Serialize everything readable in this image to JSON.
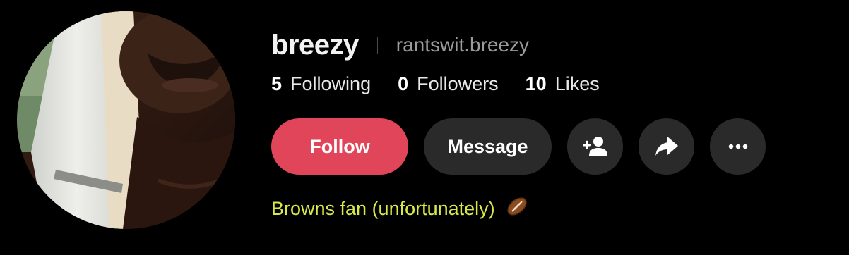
{
  "profile": {
    "display_name": "breezy",
    "username": "rantswit.breezy",
    "avatar": "profile-photo"
  },
  "stats": [
    {
      "count": "5",
      "label": "Following"
    },
    {
      "count": "0",
      "label": "Followers"
    },
    {
      "count": "10",
      "label": "Likes"
    }
  ],
  "actions": {
    "follow_label": "Follow",
    "message_label": "Message",
    "add_friend_icon": "person-plus-icon",
    "share_icon": "share-arrow-icon",
    "more_icon": "ellipsis-icon"
  },
  "bio": {
    "text": "Browns fan (unfortunately)",
    "emoji": "🏈",
    "emoji_icon": "football-icon"
  },
  "colors": {
    "follow_button": "#e14559",
    "secondary_button": "#2a2a2a",
    "bio_text": "#d9e94a",
    "username": "#9c9c9c",
    "background": "#000000"
  }
}
